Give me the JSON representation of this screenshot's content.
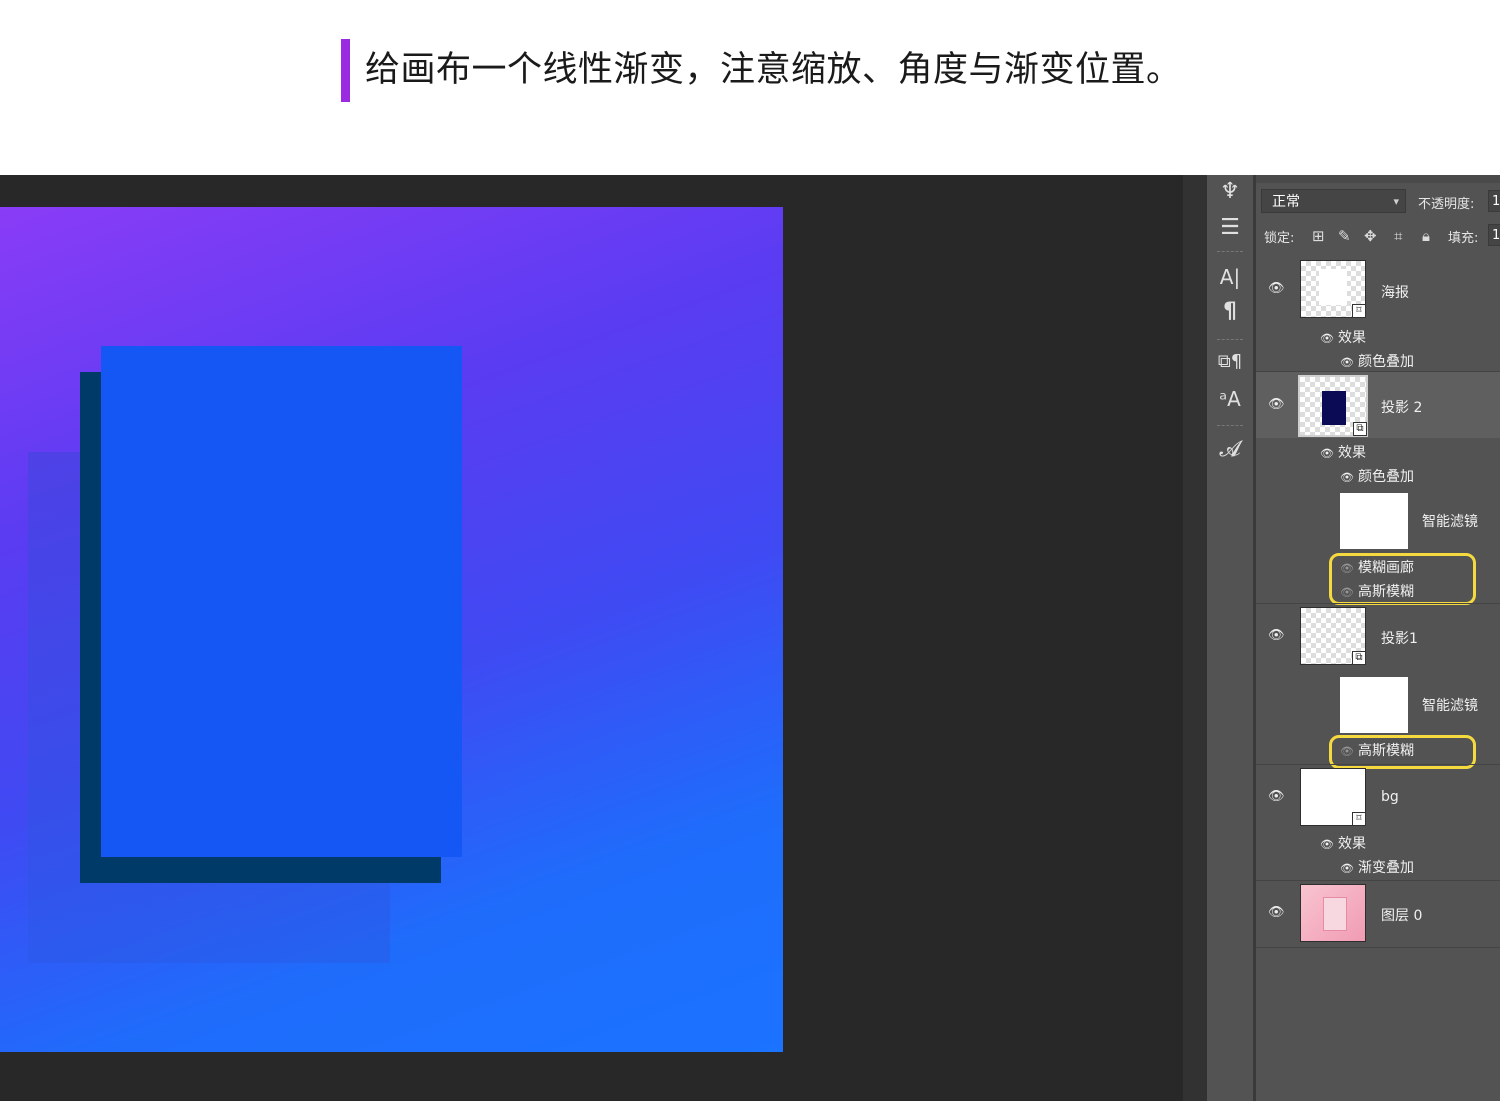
{
  "caption": {
    "text": "给画布一个线性渐变，注意缩放、角度与渐变位置。"
  },
  "toolstrip": {
    "tools": [
      {
        "name": "brush-tool-icon",
        "glyph": "♆"
      },
      {
        "name": "adjust-tool-icon",
        "glyph": "☰"
      },
      {
        "name": "character-panel-icon",
        "glyph": "A|"
      },
      {
        "name": "paragraph-panel-icon",
        "glyph": "¶"
      },
      {
        "name": "paragraph-styles-icon",
        "glyph": "⧉¶"
      },
      {
        "name": "character-styles-icon",
        "glyph": "ᵃA"
      },
      {
        "name": "glyphs-panel-icon",
        "glyph": "𝓐"
      }
    ]
  },
  "layers_panel": {
    "blend_mode": "正常",
    "opacity_label": "不透明度:",
    "opacity_value": "1",
    "lock_label": "锁定:",
    "fill_label": "填充:",
    "fill_value": "1",
    "eye_glyph": "👁",
    "layers": [
      {
        "name": "海报",
        "thumb": "checker-white",
        "effects_label": "效果",
        "effects": [
          "颜色叠加"
        ]
      },
      {
        "name": "投影 2",
        "thumb": "checker-navy",
        "selected": true,
        "effects_label": "效果",
        "effects": [
          "颜色叠加"
        ],
        "smart_filter_label": "智能滤镜",
        "filters": [
          "模糊画廊",
          "高斯模糊"
        ]
      },
      {
        "name": "投影1",
        "thumb": "checker",
        "smart_filter_label": "智能滤镜",
        "filters": [
          "高斯模糊"
        ]
      },
      {
        "name": "bg",
        "thumb": "white",
        "effects_label": "效果",
        "effects": [
          "渐变叠加"
        ]
      },
      {
        "name": "图层 0",
        "thumb": "pink"
      }
    ]
  },
  "colors": {
    "caption_accent": "#9a2be0",
    "highlight": "#f4da3f",
    "poster_blue": "#1457f5",
    "shadow_dark": "#003a68",
    "navy_thumb": "#0b0a55"
  }
}
